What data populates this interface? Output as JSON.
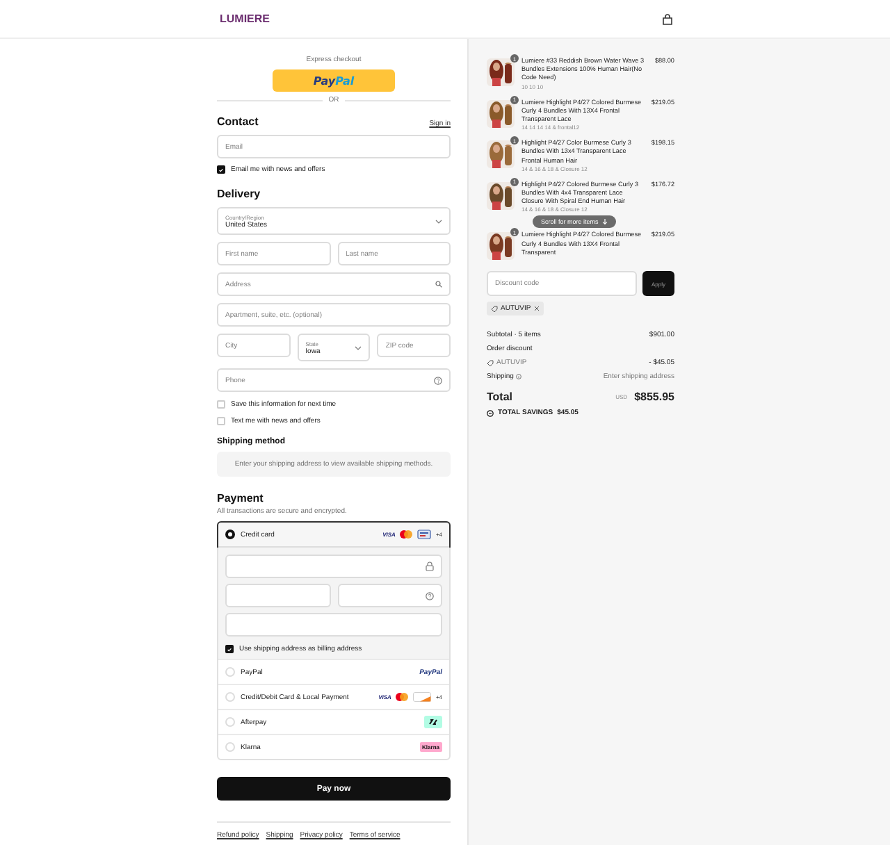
{
  "header": {
    "brand": "LUMIERE"
  },
  "express": {
    "label": "Express checkout",
    "paypal_pay": "Pay",
    "paypal_pal": "Pal",
    "or": "OR"
  },
  "contact": {
    "title": "Contact",
    "sign_in": "Sign in",
    "email": {
      "placeholder": "Email"
    },
    "newsletter": {
      "label": "Email me with news and offers",
      "checked": true
    }
  },
  "delivery": {
    "title": "Delivery",
    "country": {
      "label": "Country/Region",
      "value": "United States"
    },
    "first_name": {
      "placeholder": "First name"
    },
    "last_name": {
      "placeholder": "Last name"
    },
    "address": {
      "placeholder": "Address"
    },
    "apartment": {
      "placeholder": "Apartment, suite, etc. (optional)"
    },
    "city": {
      "placeholder": "City"
    },
    "state": {
      "label": "State",
      "value": "Iowa"
    },
    "zip": {
      "placeholder": "ZIP code"
    },
    "phone": {
      "placeholder": "Phone"
    },
    "options": [
      {
        "label": "Save this information for next time",
        "checked": false
      },
      {
        "label": "Text me with news and offers",
        "checked": false
      }
    ]
  },
  "shipping_method": {
    "title": "Shipping method",
    "notice": "Enter your shipping address to view available shipping methods."
  },
  "payment": {
    "title": "Payment",
    "subtitle": "All transactions are secure and encrypted.",
    "methods": [
      {
        "label": "Credit card",
        "selected": true,
        "logos": [
          {
            "kind": "visa",
            "text": "VISA"
          },
          {
            "kind": "mastercard"
          },
          {
            "kind": "bankcard"
          },
          {
            "kind": "more",
            "text": "+4"
          }
        ]
      },
      {
        "label": "PayPal",
        "selected": false,
        "logos": [
          {
            "kind": "paypal",
            "text": "PayPal"
          }
        ]
      },
      {
        "label": "Credit/Debit Card & Local Payment",
        "selected": false,
        "logos": [
          {
            "kind": "visa",
            "text": "VISA"
          },
          {
            "kind": "mastercard"
          },
          {
            "kind": "discover"
          },
          {
            "kind": "more",
            "text": "+4"
          }
        ]
      },
      {
        "label": "Afterpay",
        "selected": false,
        "logos": [
          {
            "kind": "afterpay"
          }
        ]
      },
      {
        "label": "Klarna",
        "selected": false,
        "logos": [
          {
            "kind": "klarna",
            "text": "Klarna"
          }
        ]
      }
    ],
    "billing": {
      "label": "Use shipping address as billing address",
      "checked": true
    }
  },
  "pay_button": "Pay now",
  "footer_links": [
    "Refund policy",
    "Shipping",
    "Privacy policy",
    "Terms of service"
  ],
  "summary": {
    "items": [
      {
        "quantity": "1",
        "name": "Lumiere #33 Reddish Brown Water Wave 3 Bundles Extensions 100% Human Hair(No Code Need)",
        "variant": "10 10 10",
        "price": "$88.00"
      },
      {
        "quantity": "1",
        "name": "Lumiere Highlight P4/27 Colored Burmese Curly 4 Bundles With 13X4 Frontal Transparent Lace",
        "variant": "14 14 14 14 & frontal12",
        "price": "$219.05"
      },
      {
        "quantity": "1",
        "name": "Highlight P4/27 Color Burmese Curly 3 Bundles With 13x4 Transparent Lace Frontal Human Hair",
        "variant": "14 & 16 & 18 & Closure 12",
        "price": "$198.15"
      },
      {
        "quantity": "1",
        "name": "Highlight P4/27 Colored Burmese Curly 3 Bundles With 4x4 Transparent Lace Closure With Spiral End Human Hair",
        "variant": "14 & 16 & 18 & Closure 12",
        "price": "$176.72"
      },
      {
        "quantity": "1",
        "name": "Lumiere Highlight P4/27 Colored Burmese Curly 4 Bundles With 13X4 Frontal Transparent",
        "price": "$219.05"
      }
    ],
    "scroll_hint": "Scroll for more items",
    "discount": {
      "placeholder": "Discount code",
      "button": "Apply"
    },
    "applied_code": "AUTUVIP",
    "subtotal": {
      "label": "Subtotal · 5 items",
      "value": "$901.00"
    },
    "order_discount": {
      "label": "Order discount",
      "code": "AUTUVIP",
      "value": "- $45.05"
    },
    "shipping": {
      "label": "Shipping",
      "value": "Enter shipping address"
    },
    "total": {
      "label": "Total",
      "currency": "USD",
      "value": "$855.95"
    },
    "savings": {
      "label": "TOTAL SAVINGS",
      "value": "$45.05"
    }
  }
}
